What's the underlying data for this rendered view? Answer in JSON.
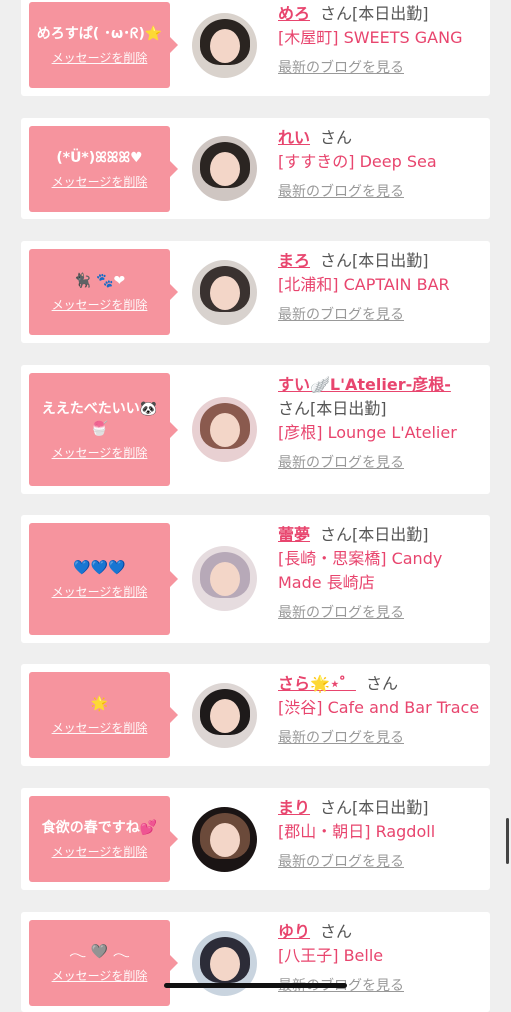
{
  "colors": {
    "accent": "#e8456e",
    "bubble": "#f6949e",
    "background": "#efefef"
  },
  "items": [
    {
      "message": "めろすぱ(  ･ω･ᖇ)⭐",
      "delete": "メッセージを削除",
      "name": "めろ",
      "san": "さん",
      "attend": "[本日出勤]",
      "shop": "[木屋町] SWEETS GANG",
      "blog": "最新のブログを見る"
    },
    {
      "message": "(*Ü*)ꕤꕤꕤ♥",
      "delete": "メッセージを削除",
      "name": "れい",
      "san": "さん",
      "attend": "",
      "shop": "[すすきの] Deep Sea",
      "blog": "最新のブログを見る"
    },
    {
      "message": "🐈‍⬛ 🐾❤",
      "delete": "メッセージを削除",
      "name": "まろ",
      "san": "さん",
      "attend": "[本日出勤]",
      "shop": "[北浦和] CAPTAIN BAR",
      "blog": "最新のブログを見る"
    },
    {
      "message": "ええたべたいい🐼🍧",
      "delete": "メッセージを削除",
      "name": "すい🪽L'Atelier-彦根-",
      "san": "さん",
      "attend": "[本日出勤]",
      "shop": "[彦根] Lounge L'Atelier",
      "blog": "最新のブログを見る"
    },
    {
      "message": "💙💙💙",
      "delete": "メッセージを削除",
      "name": "蕾夢",
      "san": "さん",
      "attend": "[本日出勤]",
      "shop": "[長崎・思案橋] Candy Made 長崎店",
      "blog": "最新のブログを見る"
    },
    {
      "message": "🌟",
      "delete": "メッセージを削除",
      "name": "さら🌟⋆゜",
      "san": "さん",
      "attend": "",
      "shop": "[渋谷] Cafe and Bar Trace",
      "blog": "最新のブログを見る"
    },
    {
      "message": "食欲の春ですね💕",
      "delete": "メッセージを削除",
      "name": "まり",
      "san": "さん",
      "attend": "[本日出勤]",
      "shop": "[郡山・朝日] Ragdoll",
      "blog": "最新のブログを見る"
    },
    {
      "message": "𓂃 🩶 𓂃",
      "delete": "メッセージを削除",
      "name": "ゆり",
      "san": "さん",
      "attend": "",
      "shop": "[八王子] Belle",
      "blog": "最新のブログを見る"
    }
  ]
}
